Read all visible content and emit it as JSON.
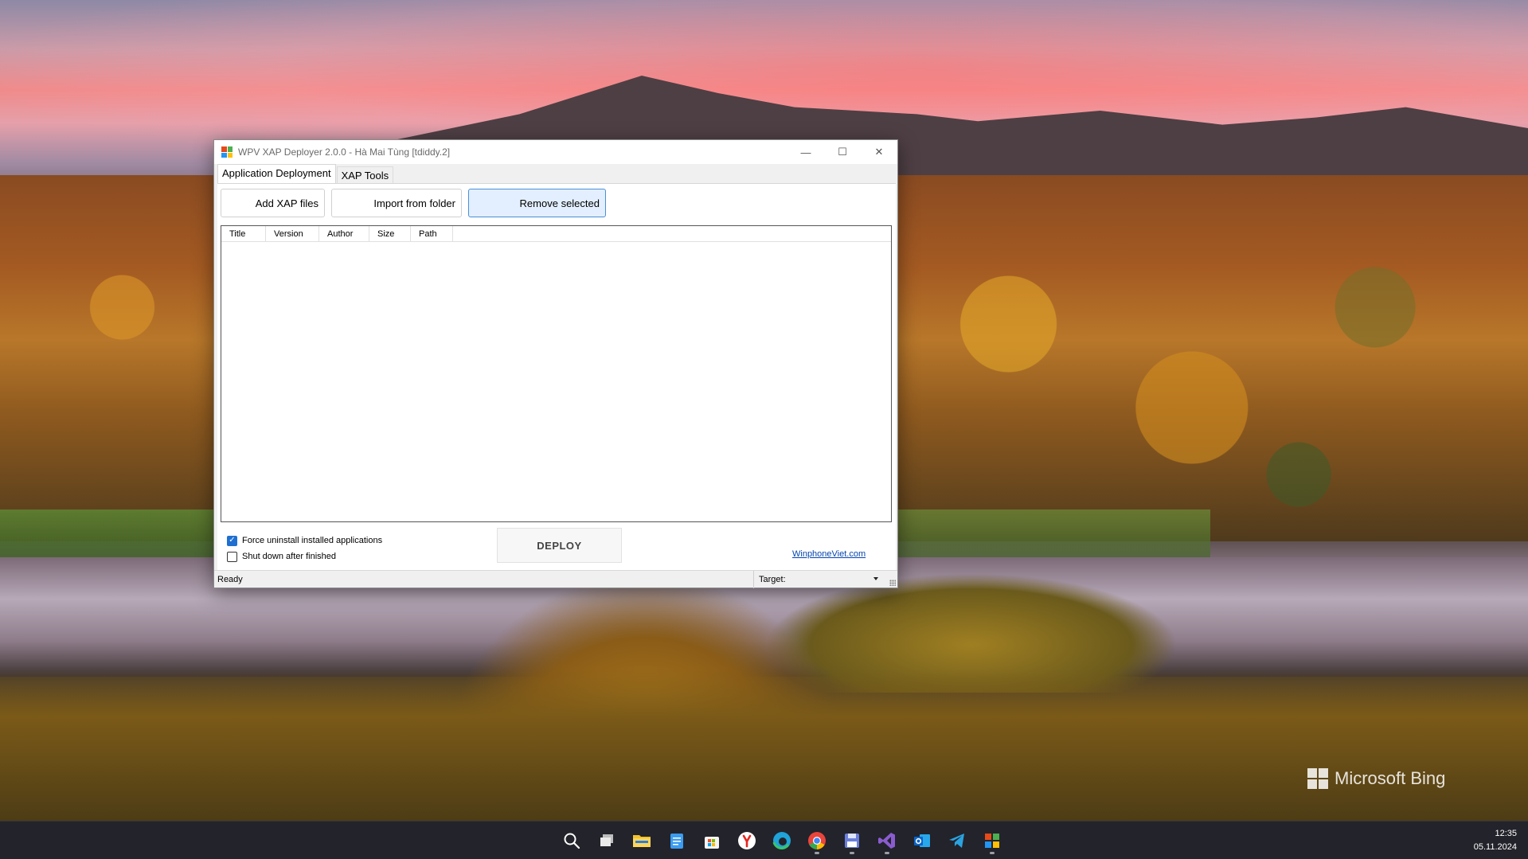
{
  "desktop": {
    "watermark": "Microsoft Bing"
  },
  "window": {
    "title": "WPV XAP Deployer 2.0.0 - Hà Mai Tùng [tdiddy.2]",
    "controls": {
      "minimize": "—",
      "maximize": "☐",
      "close": "✕"
    },
    "tabs": [
      {
        "label": "Application Deployment",
        "active": true
      },
      {
        "label": "XAP Tools",
        "active": false
      }
    ],
    "toolbar": {
      "add_label": "Add XAP files",
      "import_label": "Import from folder",
      "remove_label": "Remove selected"
    },
    "list": {
      "columns": [
        "Title",
        "Version",
        "Author",
        "Size",
        "Path"
      ],
      "rows": []
    },
    "options": {
      "force_uninstall": {
        "label": "Force uninstall installed applications",
        "checked": true
      },
      "shutdown": {
        "label": "Shut down after finished",
        "checked": false
      }
    },
    "deploy_label": "DEPLOY",
    "link_text": "WinphoneViet.com",
    "status": {
      "text": "Ready",
      "target_label": "Target:"
    }
  },
  "taskbar": {
    "icons": [
      {
        "name": "start-icon",
        "color": "#3aa0ff"
      },
      {
        "name": "search-icon",
        "color": "#ffffff"
      },
      {
        "name": "task-view-icon",
        "color": "#cfcfcf"
      },
      {
        "name": "file-explorer-icon",
        "color": "#f2c230"
      },
      {
        "name": "notepad-icon",
        "color": "#3b9cf0"
      },
      {
        "name": "microsoft-store-icon",
        "color": "#ffffff"
      },
      {
        "name": "yandex-browser-icon",
        "color": "#ffffff"
      },
      {
        "name": "edge-icon",
        "color": "#1fa3d8"
      },
      {
        "name": "chrome-icon",
        "color": "#e8453c"
      },
      {
        "name": "save-disk-icon",
        "color": "#6b7fd8"
      },
      {
        "name": "visual-studio-icon",
        "color": "#8a5cd0"
      },
      {
        "name": "outlook-icon",
        "color": "#1173d4"
      },
      {
        "name": "telegram-icon",
        "color": "#2aa3e0"
      },
      {
        "name": "xap-deployer-icon",
        "color": "#f2b400"
      }
    ],
    "clock": {
      "time": "12:35",
      "date": "05.11.2024"
    }
  }
}
